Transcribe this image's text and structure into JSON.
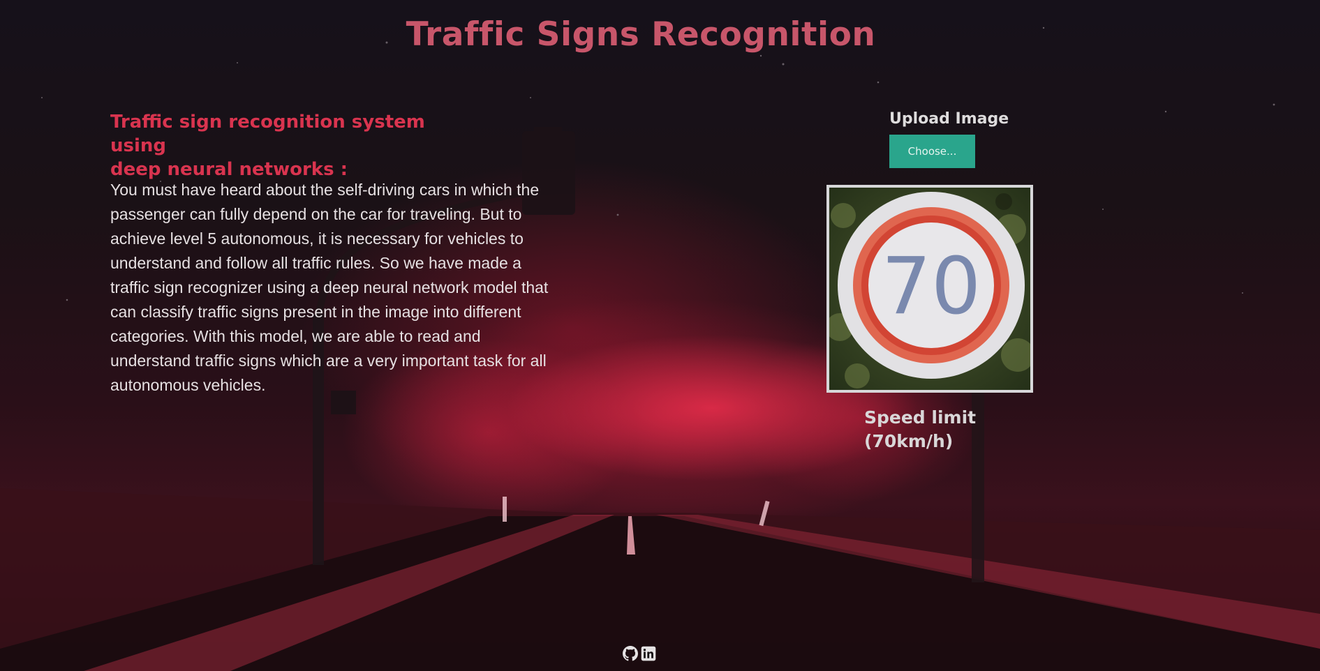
{
  "header": {
    "title": "Traffic Signs Recognition"
  },
  "intro": {
    "subtitle_line1": "Traffic sign recognition system using",
    "subtitle_line2": "deep neural networks :",
    "description": "You must have heard about the self-driving cars in which the passenger can fully depend on the car for traveling. But to achieve level 5 autonomous, it is necessary for vehicles to understand and follow all traffic rules. So we have made a traffic sign recognizer using a deep neural network model that can classify traffic signs present in the image into different categories. With this model, we are able to read and understand traffic signs which are a very important task for all autonomous vehicles."
  },
  "upload": {
    "label": "Upload Image",
    "button_label": "Choose...",
    "preview_sign_text": "70"
  },
  "result": {
    "line1": "Speed limit",
    "line2": "(70km/h)"
  },
  "footer": {
    "icons": [
      "github-icon",
      "linkedin-icon"
    ]
  },
  "colors": {
    "title": "#c8566a",
    "subtitle": "#d9344f",
    "button": "#2aa58c",
    "text": "#e6e0e2"
  }
}
